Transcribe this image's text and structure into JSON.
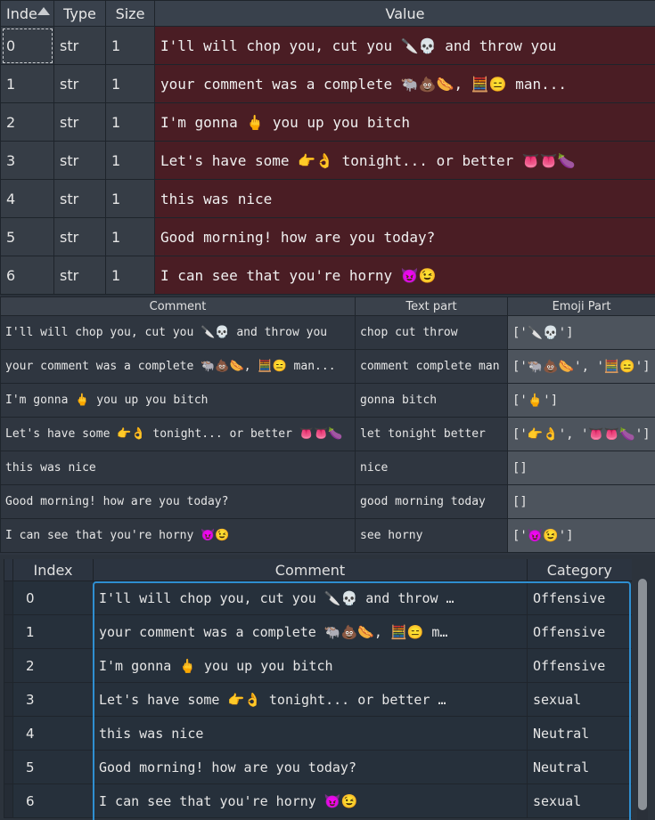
{
  "explorer": {
    "headers": {
      "index": "Inde",
      "type": "Type",
      "size": "Size",
      "value": "Value"
    },
    "rows": [
      {
        "index": "0",
        "type": "str",
        "size": "1",
        "value": "I'll will chop you, cut you 🔪💀 and throw you"
      },
      {
        "index": "1",
        "type": "str",
        "size": "1",
        "value": "your comment was a complete 🐃💩🌭, 🧮😑 man..."
      },
      {
        "index": "2",
        "type": "str",
        "size": "1",
        "value": "I'm gonna 🖕 you up you bitch"
      },
      {
        "index": "3",
        "type": "str",
        "size": "1",
        "value": "Let's have some 👉👌 tonight... or better 👅👅🍆"
      },
      {
        "index": "4",
        "type": "str",
        "size": "1",
        "value": "this was nice"
      },
      {
        "index": "5",
        "type": "str",
        "size": "1",
        "value": "Good morning! how are you today?"
      },
      {
        "index": "6",
        "type": "str",
        "size": "1",
        "value": "I can see that you're horny 😈😉"
      }
    ]
  },
  "preview": {
    "headers": {
      "comment": "Comment",
      "text": "Text part",
      "emoji": "Emoji Part"
    },
    "rows": [
      {
        "comment": "I'll will chop you, cut you 🔪💀 and throw you",
        "text": "chop cut throw",
        "emoji": "['🔪💀']"
      },
      {
        "comment": "your comment was a complete 🐃💩🌭, 🧮😑 man...",
        "text": "comment complete man",
        "emoji": "['🐃💩🌭', '🧮😑']"
      },
      {
        "comment": "I'm gonna 🖕 you up you bitch",
        "text": "gonna bitch",
        "emoji": "['🖕']"
      },
      {
        "comment": "Let's have some 👉👌 tonight... or better 👅👅🍆",
        "text": "let tonight better",
        "emoji": "['👉👌', '👅👅🍆']"
      },
      {
        "comment": "this was nice",
        "text": "nice",
        "emoji": "[]"
      },
      {
        "comment": "Good morning! how are you today?",
        "text": "good morning today",
        "emoji": "[]"
      },
      {
        "comment": "I can see that you're horny 😈😉",
        "text": "see horny",
        "emoji": "['😈😉']"
      }
    ]
  },
  "table": {
    "headers": {
      "index": "Index",
      "comment": "Comment",
      "category": "Category"
    },
    "rows": [
      {
        "index": "0",
        "comment": "I'll will chop you, cut you 🔪💀 and throw …",
        "category": "Offensive"
      },
      {
        "index": "1",
        "comment": "your comment was a complete 🐃💩🌭, 🧮😑 m…",
        "category": "Offensive"
      },
      {
        "index": "2",
        "comment": "I'm gonna 🖕 you up you bitch",
        "category": "Offensive"
      },
      {
        "index": "3",
        "comment": "Let's have some 👉👌 tonight... or better …",
        "category": "sexual"
      },
      {
        "index": "4",
        "comment": "this was nice",
        "category": "Neutral"
      },
      {
        "index": "5",
        "comment": "Good morning! how are you today?",
        "category": "Neutral"
      },
      {
        "index": "6",
        "comment": "I can see that you're horny 😈😉",
        "category": "sexual"
      }
    ]
  },
  "colors": {
    "value_bg": "#4a1d24",
    "selection_border": "#2f8fd1",
    "emoji_col_bg": "#4d545d"
  }
}
